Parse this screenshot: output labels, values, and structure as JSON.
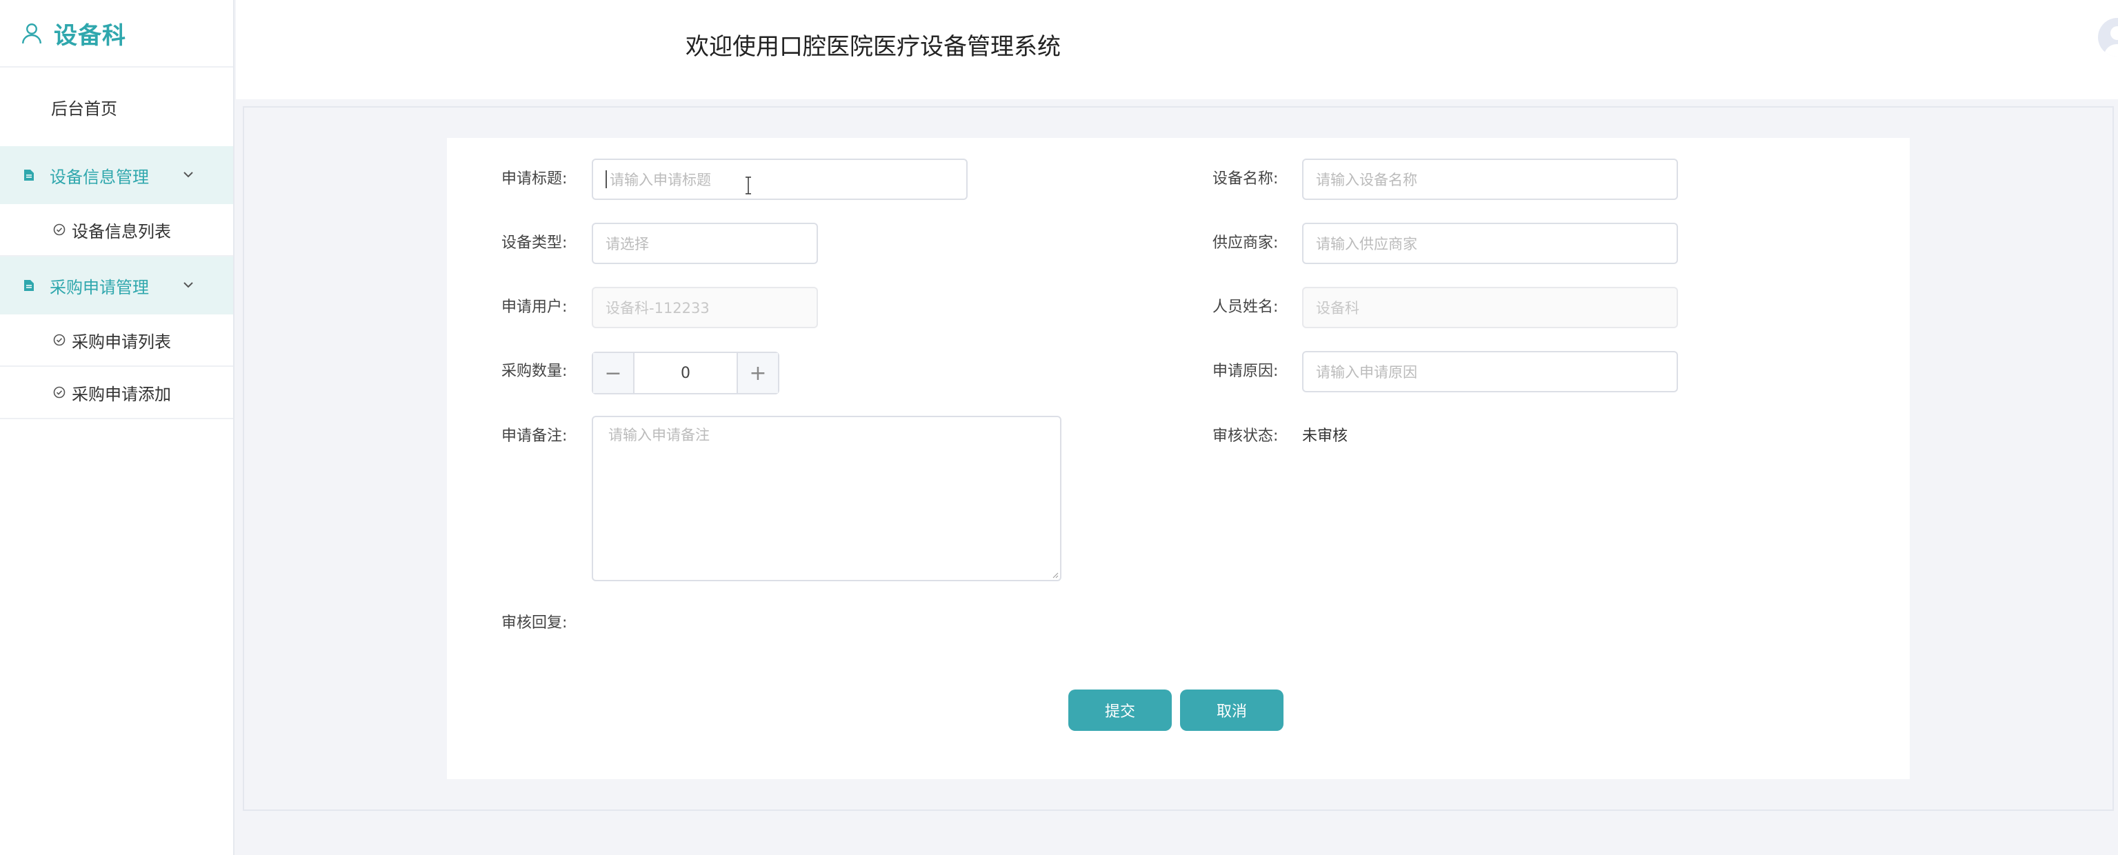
{
  "sidebar": {
    "brand": "设备科",
    "home": "后台首页",
    "groups": [
      {
        "label": "设备信息管理",
        "items": [
          "设备信息列表"
        ]
      },
      {
        "label": "采购申请管理",
        "items": [
          "采购申请列表",
          "采购申请添加"
        ]
      }
    ]
  },
  "header": {
    "title": "欢迎使用口腔医院医疗设备管理系统"
  },
  "form": {
    "title": {
      "label": "申请标题:",
      "placeholder": "请输入申请标题"
    },
    "device_name": {
      "label": "设备名称:",
      "placeholder": "请输入设备名称"
    },
    "device_type": {
      "label": "设备类型:",
      "placeholder": "请选择"
    },
    "supplier": {
      "label": "供应商家:",
      "placeholder": "请输入供应商家"
    },
    "applicant": {
      "label": "申请用户:",
      "value": "设备科-112233"
    },
    "person_name": {
      "label": "人员姓名:",
      "value": "设备科"
    },
    "quantity": {
      "label": "采购数量:",
      "value": "0",
      "minus": "−",
      "plus": "+"
    },
    "reason": {
      "label": "申请原因:",
      "placeholder": "请输入申请原因"
    },
    "remark": {
      "label": "申请备注:",
      "placeholder": "请输入申请备注"
    },
    "review_status": {
      "label": "审核状态:",
      "value": "未审核"
    },
    "review_reply": {
      "label": "审核回复:"
    }
  },
  "actions": {
    "submit": "提交",
    "cancel": "取消"
  },
  "colors": {
    "accent": "#3aa8b1",
    "menu_active_bg": "#e7f4f4"
  }
}
